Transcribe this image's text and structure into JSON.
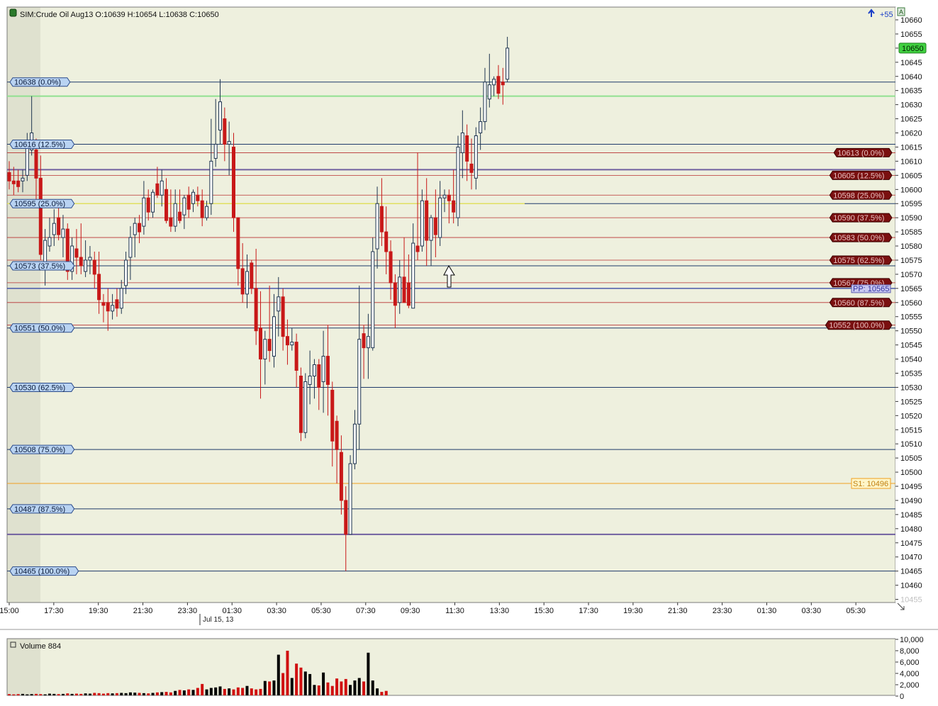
{
  "app": {
    "price_header": "SIM:Crude Oil Aug13 O:10639 H:10654 L:10638 C:10650",
    "up_indicator": "+55",
    "volume_header": "Volume 884",
    "date_marker": "Jul 15, 13"
  },
  "colors": {
    "panel_bg": "#eef0de",
    "session_shade": "#dfe1cf",
    "up_candle": "#1f3550",
    "down_candle": "#c81818",
    "fib_blue_line": "#1f3a6a",
    "fib_red_line": "#b83030",
    "fib_blue_label_bg": "#b9d3f2",
    "fib_red_label_bg": "#7a1010",
    "pivot_purple": "#7060a0",
    "s1_orange": "#f0a020",
    "green_line": "#90e090",
    "yellow_line": "#e0e060"
  },
  "chart_data": [
    {
      "type": "candlestick",
      "title": "SIM:Crude Oil Aug13 O:10639 H:10654 L:10638 C:10650",
      "x_ticks": [
        "15:00",
        "17:30",
        "19:30",
        "21:30",
        "23:30",
        "01:30",
        "03:30",
        "05:30",
        "07:30",
        "09:30",
        "11:30",
        "13:30",
        "15:30",
        "17:30",
        "19:30",
        "21:30",
        "23:30",
        "01:30",
        "03:30",
        "05:30"
      ],
      "y_ticks": [
        10660,
        10655,
        10650,
        10645,
        10640,
        10635,
        10630,
        10625,
        10620,
        10615,
        10610,
        10605,
        10600,
        10595,
        10590,
        10585,
        10580,
        10575,
        10570,
        10565,
        10560,
        10555,
        10550,
        10545,
        10540,
        10535,
        10530,
        10525,
        10520,
        10515,
        10510,
        10505,
        10500,
        10495,
        10490,
        10485,
        10480,
        10475,
        10470,
        10465,
        10460,
        10455
      ],
      "ylim": [
        10455,
        10660
      ],
      "last_price": "10650",
      "candles": [
        {
          "o": 10606,
          "h": 10610,
          "l": 10600,
          "c": 10603
        },
        {
          "o": 10603,
          "h": 10608,
          "l": 10598,
          "c": 10602
        },
        {
          "o": 10603,
          "h": 10607,
          "l": 10599,
          "c": 10601
        },
        {
          "o": 10603,
          "h": 10607,
          "l": 10599,
          "c": 10604
        },
        {
          "o": 10605,
          "h": 10620,
          "l": 10603,
          "c": 10615
        },
        {
          "o": 10614,
          "h": 10633,
          "l": 10612,
          "c": 10620
        },
        {
          "o": 10614,
          "h": 10618,
          "l": 10596,
          "c": 10604
        },
        {
          "o": 10604,
          "h": 10612,
          "l": 10575,
          "c": 10577
        },
        {
          "o": 10574,
          "h": 10586,
          "l": 10566,
          "c": 10582
        },
        {
          "o": 10580,
          "h": 10590,
          "l": 10578,
          "c": 10583
        },
        {
          "o": 10584,
          "h": 10593,
          "l": 10580,
          "c": 10588
        },
        {
          "o": 10590,
          "h": 10595,
          "l": 10582,
          "c": 10584
        },
        {
          "o": 10583,
          "h": 10591,
          "l": 10576,
          "c": 10586
        },
        {
          "o": 10586,
          "h": 10588,
          "l": 10568,
          "c": 10571
        },
        {
          "o": 10571,
          "h": 10583,
          "l": 10568,
          "c": 10580
        },
        {
          "o": 10579,
          "h": 10586,
          "l": 10570,
          "c": 10576
        },
        {
          "o": 10576,
          "h": 10588,
          "l": 10570,
          "c": 10573
        },
        {
          "o": 10571,
          "h": 10582,
          "l": 10569,
          "c": 10575
        },
        {
          "o": 10575,
          "h": 10580,
          "l": 10570,
          "c": 10576
        },
        {
          "o": 10575,
          "h": 10578,
          "l": 10565,
          "c": 10570
        },
        {
          "o": 10570,
          "h": 10578,
          "l": 10556,
          "c": 10561
        },
        {
          "o": 10560,
          "h": 10563,
          "l": 10553,
          "c": 10559
        },
        {
          "o": 10560,
          "h": 10565,
          "l": 10550,
          "c": 10557
        },
        {
          "o": 10557,
          "h": 10563,
          "l": 10554,
          "c": 10559
        },
        {
          "o": 10561,
          "h": 10565,
          "l": 10555,
          "c": 10558
        },
        {
          "o": 10558,
          "h": 10568,
          "l": 10556,
          "c": 10565
        },
        {
          "o": 10566,
          "h": 10578,
          "l": 10563,
          "c": 10575
        },
        {
          "o": 10576,
          "h": 10587,
          "l": 10568,
          "c": 10583
        },
        {
          "o": 10584,
          "h": 10590,
          "l": 10576,
          "c": 10588
        },
        {
          "o": 10588,
          "h": 10591,
          "l": 10581,
          "c": 10585
        },
        {
          "o": 10587,
          "h": 10603,
          "l": 10584,
          "c": 10597
        },
        {
          "o": 10597,
          "h": 10600,
          "l": 10589,
          "c": 10592
        },
        {
          "o": 10592,
          "h": 10600,
          "l": 10590,
          "c": 10599
        },
        {
          "o": 10602,
          "h": 10608,
          "l": 10597,
          "c": 10598
        },
        {
          "o": 10598,
          "h": 10607,
          "l": 10594,
          "c": 10603
        },
        {
          "o": 10600,
          "h": 10604,
          "l": 10588,
          "c": 10589
        },
        {
          "o": 10590,
          "h": 10600,
          "l": 10585,
          "c": 10587
        },
        {
          "o": 10587,
          "h": 10600,
          "l": 10585,
          "c": 10595
        },
        {
          "o": 10592,
          "h": 10600,
          "l": 10588,
          "c": 10589
        },
        {
          "o": 10591,
          "h": 10598,
          "l": 10586,
          "c": 10597
        },
        {
          "o": 10598,
          "h": 10601,
          "l": 10590,
          "c": 10593
        },
        {
          "o": 10595,
          "h": 10600,
          "l": 10592,
          "c": 10599
        },
        {
          "o": 10598,
          "h": 10601,
          "l": 10594,
          "c": 10596
        },
        {
          "o": 10596,
          "h": 10600,
          "l": 10587,
          "c": 10590
        },
        {
          "o": 10590,
          "h": 10596,
          "l": 10589,
          "c": 10594
        },
        {
          "o": 10595,
          "h": 10625,
          "l": 10591,
          "c": 10610
        },
        {
          "o": 10611,
          "h": 10632,
          "l": 10608,
          "c": 10616
        },
        {
          "o": 10621,
          "h": 10639,
          "l": 10616,
          "c": 10631
        },
        {
          "o": 10625,
          "h": 10629,
          "l": 10610,
          "c": 10616
        },
        {
          "o": 10616,
          "h": 10624,
          "l": 10605,
          "c": 10617
        },
        {
          "o": 10615,
          "h": 10620,
          "l": 10585,
          "c": 10590
        },
        {
          "o": 10590,
          "h": 10590,
          "l": 10566,
          "c": 10572
        },
        {
          "o": 10572,
          "h": 10581,
          "l": 10560,
          "c": 10563
        },
        {
          "o": 10563,
          "h": 10577,
          "l": 10558,
          "c": 10571
        },
        {
          "o": 10574,
          "h": 10575,
          "l": 10563,
          "c": 10565
        },
        {
          "o": 10565,
          "h": 10579,
          "l": 10545,
          "c": 10550
        },
        {
          "o": 10551,
          "h": 10564,
          "l": 10526,
          "c": 10540
        },
        {
          "o": 10540,
          "h": 10550,
          "l": 10531,
          "c": 10547
        },
        {
          "o": 10547,
          "h": 10566,
          "l": 10539,
          "c": 10543
        },
        {
          "o": 10541,
          "h": 10563,
          "l": 10537,
          "c": 10555
        },
        {
          "o": 10557,
          "h": 10569,
          "l": 10548,
          "c": 10562
        },
        {
          "o": 10562,
          "h": 10565,
          "l": 10543,
          "c": 10548
        },
        {
          "o": 10548,
          "h": 10554,
          "l": 10538,
          "c": 10545
        },
        {
          "o": 10545,
          "h": 10551,
          "l": 10543,
          "c": 10546
        },
        {
          "o": 10546,
          "h": 10549,
          "l": 10530,
          "c": 10536
        },
        {
          "o": 10534,
          "h": 10537,
          "l": 10511,
          "c": 10514
        },
        {
          "o": 10514,
          "h": 10535,
          "l": 10512,
          "c": 10532
        },
        {
          "o": 10531,
          "h": 10543,
          "l": 10524,
          "c": 10534
        },
        {
          "o": 10534,
          "h": 10540,
          "l": 10526,
          "c": 10538
        },
        {
          "o": 10538,
          "h": 10540,
          "l": 10522,
          "c": 10530
        },
        {
          "o": 10532,
          "h": 10550,
          "l": 10521,
          "c": 10541
        },
        {
          "o": 10541,
          "h": 10552,
          "l": 10520,
          "c": 10531
        },
        {
          "o": 10529,
          "h": 10532,
          "l": 10502,
          "c": 10511
        },
        {
          "o": 10518,
          "h": 10520,
          "l": 10496,
          "c": 10508
        },
        {
          "o": 10507,
          "h": 10513,
          "l": 10485,
          "c": 10490
        },
        {
          "o": 10490,
          "h": 10495,
          "l": 10465,
          "c": 10478
        },
        {
          "o": 10478,
          "h": 10506,
          "l": 10478,
          "c": 10503
        },
        {
          "o": 10503,
          "h": 10522,
          "l": 10501,
          "c": 10517
        },
        {
          "o": 10517,
          "h": 10566,
          "l": 10508,
          "c": 10547
        },
        {
          "o": 10549,
          "h": 10552,
          "l": 10533,
          "c": 10544
        },
        {
          "o": 10544,
          "h": 10556,
          "l": 10533,
          "c": 10548
        },
        {
          "o": 10544,
          "h": 10583,
          "l": 10543,
          "c": 10578
        },
        {
          "o": 10579,
          "h": 10601,
          "l": 10572,
          "c": 10595
        },
        {
          "o": 10594,
          "h": 10604,
          "l": 10580,
          "c": 10585
        },
        {
          "o": 10585,
          "h": 10594,
          "l": 10570,
          "c": 10578
        },
        {
          "o": 10578,
          "h": 10582,
          "l": 10561,
          "c": 10567
        },
        {
          "o": 10567,
          "h": 10570,
          "l": 10551,
          "c": 10559
        },
        {
          "o": 10560,
          "h": 10575,
          "l": 10556,
          "c": 10569
        },
        {
          "o": 10569,
          "h": 10583,
          "l": 10560,
          "c": 10560
        },
        {
          "o": 10567,
          "h": 10577,
          "l": 10558,
          "c": 10559
        },
        {
          "o": 10558,
          "h": 10588,
          "l": 10558,
          "c": 10581
        },
        {
          "o": 10580,
          "h": 10613,
          "l": 10575,
          "c": 10578
        },
        {
          "o": 10580,
          "h": 10600,
          "l": 10578,
          "c": 10596
        },
        {
          "o": 10596,
          "h": 10604,
          "l": 10573,
          "c": 10582
        },
        {
          "o": 10582,
          "h": 10591,
          "l": 10573,
          "c": 10590
        },
        {
          "o": 10590,
          "h": 10600,
          "l": 10576,
          "c": 10584
        },
        {
          "o": 10583,
          "h": 10603,
          "l": 10580,
          "c": 10597
        },
        {
          "o": 10597,
          "h": 10600,
          "l": 10592,
          "c": 10598
        },
        {
          "o": 10598,
          "h": 10600,
          "l": 10588,
          "c": 10596
        },
        {
          "o": 10596,
          "h": 10607,
          "l": 10588,
          "c": 10592
        },
        {
          "o": 10590,
          "h": 10619,
          "l": 10587,
          "c": 10615
        },
        {
          "o": 10613,
          "h": 10628,
          "l": 10604,
          "c": 10620
        },
        {
          "o": 10619,
          "h": 10623,
          "l": 10603,
          "c": 10610
        },
        {
          "o": 10609,
          "h": 10618,
          "l": 10600,
          "c": 10606
        },
        {
          "o": 10604,
          "h": 10622,
          "l": 10600,
          "c": 10619
        },
        {
          "o": 10620,
          "h": 10629,
          "l": 10614,
          "c": 10624
        },
        {
          "o": 10624,
          "h": 10643,
          "l": 10621,
          "c": 10638
        },
        {
          "o": 10632,
          "h": 10648,
          "l": 10629,
          "c": 10637
        },
        {
          "o": 10637,
          "h": 10640,
          "l": 10633,
          "c": 10639
        },
        {
          "o": 10640,
          "h": 10644,
          "l": 10632,
          "c": 10634
        },
        {
          "o": 10638,
          "h": 10643,
          "l": 10630,
          "c": 10637
        },
        {
          "o": 10639,
          "h": 10654,
          "l": 10638,
          "c": 10650
        }
      ],
      "fib_levels_blue": [
        {
          "price": 10638,
          "label": "10638 (0.0%)"
        },
        {
          "price": 10616,
          "label": "10616 (12.5%)"
        },
        {
          "price": 10595,
          "label": "10595 (25.0%)"
        },
        {
          "price": 10573,
          "label": "10573 (37.5%)"
        },
        {
          "price": 10551,
          "label": "10551 (50.0%)"
        },
        {
          "price": 10530,
          "label": "10530 (62.5%)"
        },
        {
          "price": 10508,
          "label": "10508 (75.0%)"
        },
        {
          "price": 10487,
          "label": "10487 (87.5%)"
        },
        {
          "price": 10465,
          "label": "10465 (100.0%)"
        }
      ],
      "fib_levels_red": [
        {
          "price": 10613,
          "label": "10613 (0.0%)"
        },
        {
          "price": 10605,
          "label": "10605 (12.5%)"
        },
        {
          "price": 10598,
          "label": "10598 (25.0%)"
        },
        {
          "price": 10590,
          "label": "10590 (37.5%)"
        },
        {
          "price": 10583,
          "label": "10583 (50.0%)"
        },
        {
          "price": 10575,
          "label": "10575 (62.5%)"
        },
        {
          "price": 10567,
          "label": "10567 (75.0%)"
        },
        {
          "price": 10560,
          "label": "10560 (87.5%)"
        },
        {
          "price": 10552,
          "label": "10552 (100.0%)"
        }
      ],
      "pivot_label": "PP: 10565",
      "pivot_price": 10565,
      "s1_label": "S1: 10496",
      "s1_price": 10496,
      "purple_lines": [
        10607,
        10478
      ],
      "green_line_price": 10633,
      "yellow_line_price": 10595
    },
    {
      "type": "bar",
      "title": "Volume 884",
      "y_ticks": [
        "10,000",
        "8,000",
        "6,000",
        "4,000",
        "2,000",
        "0"
      ],
      "ylim": [
        0,
        10000
      ],
      "values": [
        250,
        200,
        250,
        300,
        200,
        250,
        300,
        250,
        200,
        350,
        300,
        250,
        300,
        400,
        300,
        350,
        300,
        400,
        350,
        500,
        450,
        350,
        450,
        400,
        450,
        500,
        450,
        600,
        550,
        500,
        450,
        400,
        500,
        600,
        650,
        700,
        600,
        900,
        1100,
        1000,
        1200,
        1100,
        1500,
        2300,
        1200,
        1500,
        1600,
        1800,
        1300,
        1400,
        1200,
        1600,
        1500,
        1900,
        1400,
        1200,
        1300,
        2900,
        2800,
        3000,
        8200,
        4500,
        9000,
        3500,
        6400,
        5600,
        4800,
        4300,
        2100,
        2000,
        4600,
        2600,
        1900,
        3400,
        2800,
        3300,
        2100,
        3000,
        3500,
        2800,
        8600,
        3000,
        1400,
        700,
        900
      ]
    }
  ]
}
